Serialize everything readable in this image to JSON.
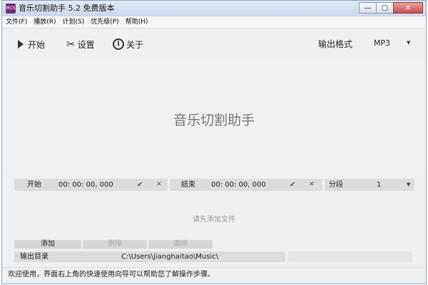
{
  "window": {
    "title": "音乐切割助手 5.2 免费版本",
    "icon_text": "MCS",
    "controls": {
      "minimize": "—",
      "maximize": "▢",
      "close": "✕"
    }
  },
  "menu": [
    "文件(F)",
    "播放(R)",
    "计划(S)",
    "优先级(P)",
    "帮助(H)"
  ],
  "toolbar": {
    "start_label": "开始",
    "settings_label": "设置",
    "about_label": "关于",
    "output_format_label": "输出格式",
    "output_format_value": "MP3",
    "dropdown_arrow": "▼"
  },
  "main": {
    "drop_title": "音乐切割助手"
  },
  "segment": {
    "start_label": "开始",
    "start_time": "00:  00:  00,  000",
    "end_label": "结束",
    "end_time": "00:  00:  00,  000",
    "confirm_glyph": "✔",
    "clear_glyph": "✕",
    "split_label": "分段",
    "split_value": "1"
  },
  "hint": "请先添加文件",
  "actions": {
    "add": "添加",
    "delete": "删除",
    "clear": "清除"
  },
  "output_dir": {
    "label": "输出目录",
    "path": "C:\\Users\\jianghaitao\\Music\\"
  },
  "status_text": "欢迎使用，界面右上角的快速使用向导可以帮助您了解操作步骤。"
}
